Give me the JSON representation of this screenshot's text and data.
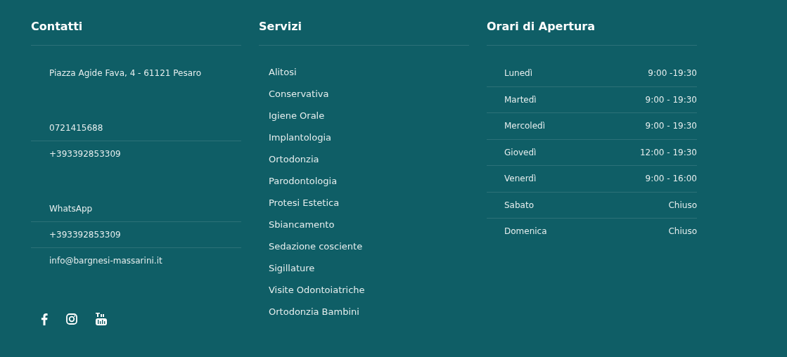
{
  "columns": [
    {
      "kind": "contacts",
      "title": "Contatti",
      "groups": [
        [
          "Piazza Agide Fava, 4 - 61121 Pesaro"
        ],
        [
          "0721415688",
          "+393392853309"
        ],
        [
          "WhatsApp",
          "+393392853309",
          "info@bargnesi-massarini.it"
        ]
      ]
    },
    {
      "kind": "links",
      "title": "Servizi",
      "items": [
        "Alitosi",
        "Conservativa",
        "Igiene Orale",
        "Implantologia",
        "Ortodonzia",
        "Parodontologia",
        "Protesi Estetica",
        "Sbiancamento",
        "Sedazione cosciente",
        "Sigillature",
        "Visite Odontoiatriche",
        "Ortodonzia Bambini"
      ]
    },
    {
      "kind": "hours",
      "title": "Orari di Apertura",
      "rows": [
        {
          "day": "Lunedì",
          "hours": "9:00 -19:30"
        },
        {
          "day": "Martedì",
          "hours": "9:00 - 19:30"
        },
        {
          "day": "Mercoledì",
          "hours": "9:00 - 19:30"
        },
        {
          "day": "Giovedì",
          "hours": "12:00 - 19:30"
        },
        {
          "day": "Venerdì",
          "hours": "9:00 - 16:00"
        },
        {
          "day": "Sabato",
          "hours": "Chiuso"
        },
        {
          "day": "Domenica",
          "hours": "Chiuso"
        }
      ]
    }
  ]
}
